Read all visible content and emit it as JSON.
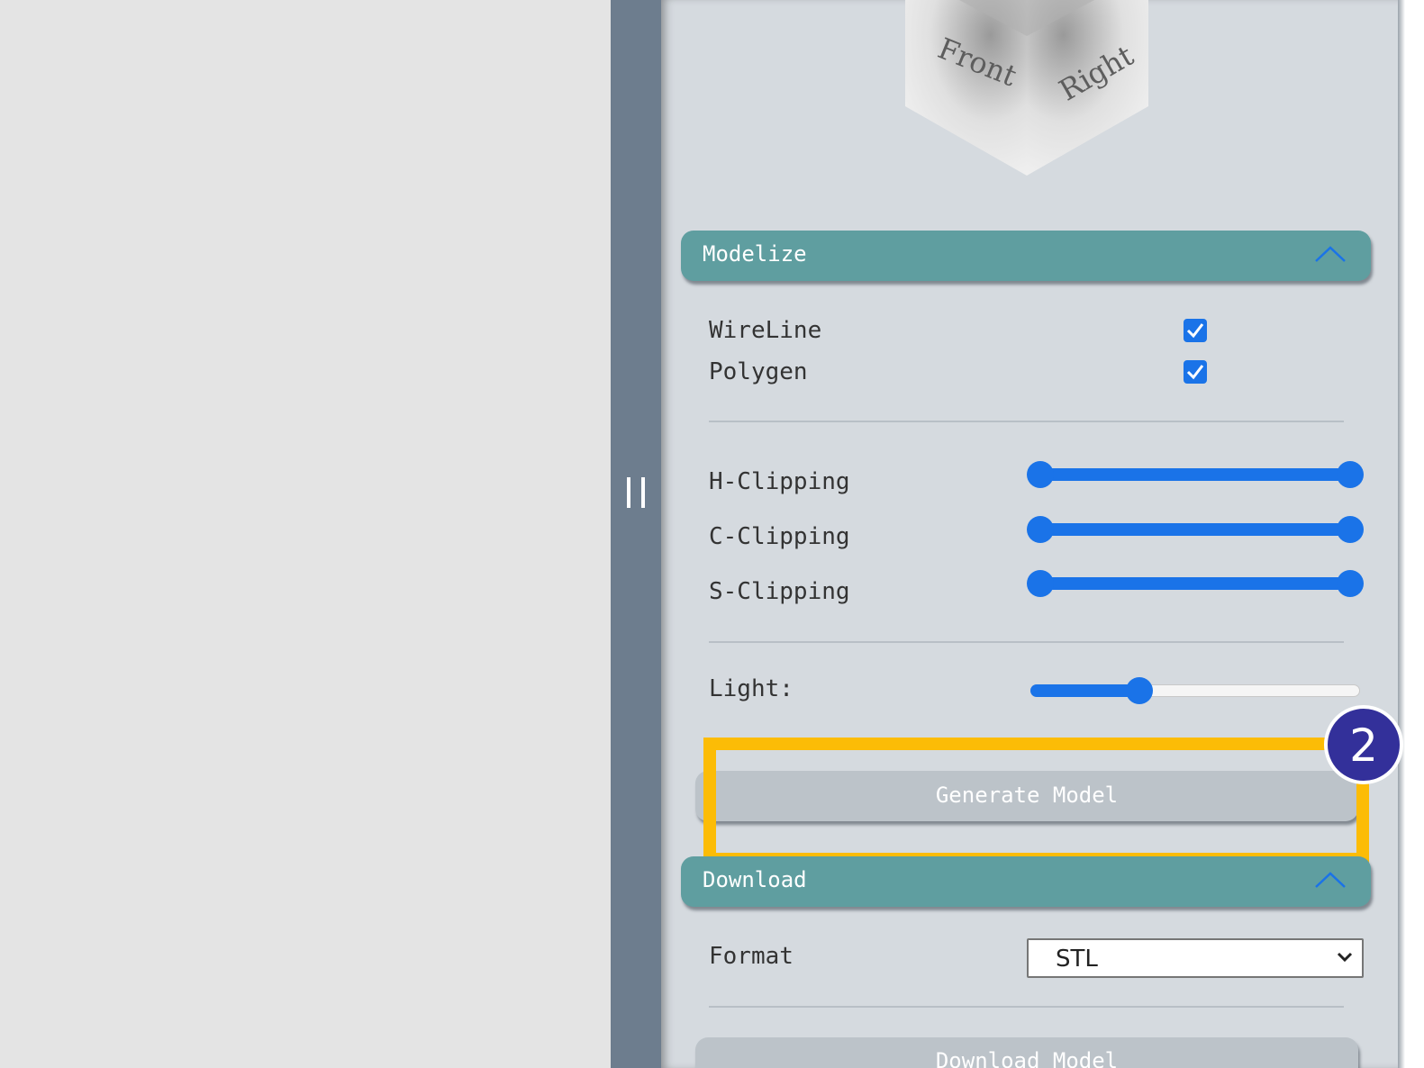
{
  "viewcube": {
    "front_label": "Front",
    "right_label": "Right"
  },
  "modelize": {
    "title": "Modelize",
    "expanded": true,
    "options": [
      {
        "label": "WireLine",
        "checked": true
      },
      {
        "label": "Polygen",
        "checked": true
      }
    ],
    "clipping": [
      {
        "label": "H-Clipping",
        "range": [
          0,
          100
        ]
      },
      {
        "label": "C-Clipping",
        "range": [
          0,
          100
        ]
      },
      {
        "label": "S-Clipping",
        "range": [
          0,
          100
        ]
      }
    ],
    "light": {
      "label": "Light:",
      "value_percent": 32
    },
    "generate_button": "Generate Model"
  },
  "download": {
    "title": "Download",
    "expanded": true,
    "format_label": "Format",
    "format_value": "STL",
    "download_button": "Download Model"
  },
  "annotation": {
    "step_number": "2",
    "highlight_color": "#fcbc06",
    "badge_color": "#33309a"
  },
  "colors": {
    "header": "#5f9ea0",
    "accent": "#1a73e8",
    "splitter": "#6d7d8e"
  }
}
